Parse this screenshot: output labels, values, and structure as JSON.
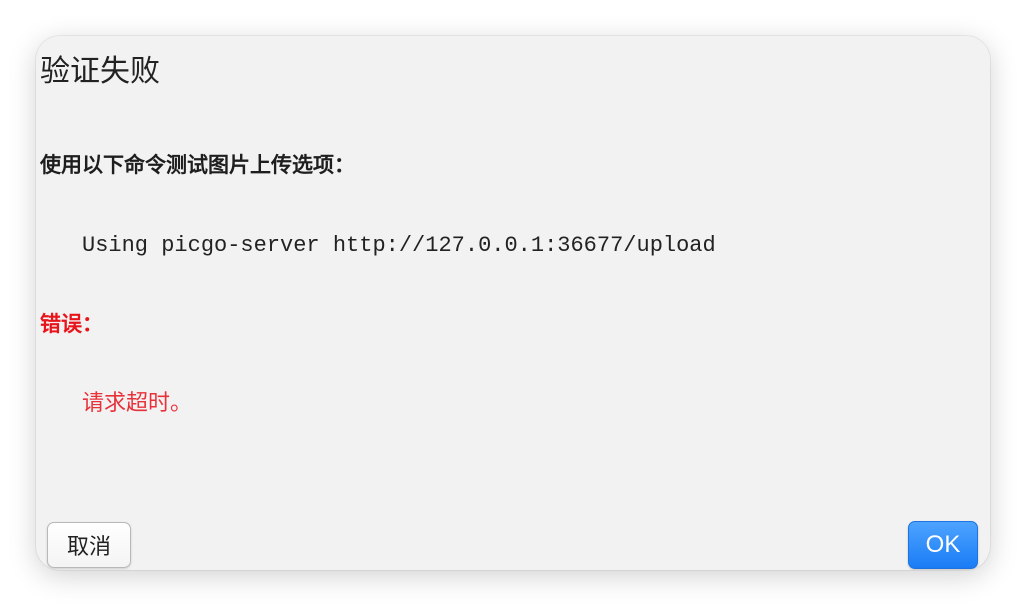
{
  "dialog": {
    "title": "验证失败",
    "command_label": "使用以下命令测试图片上传选项：",
    "command": "Using picgo-server http://127.0.0.1:36677/upload",
    "error_label": "错误：",
    "error_message": "请求超时。",
    "cancel_label": "取消",
    "ok_label": "OK"
  },
  "colors": {
    "dialog_bg": "#f2f2f2",
    "error_red": "#e8141b",
    "ok_blue": "#1a7cf5"
  }
}
